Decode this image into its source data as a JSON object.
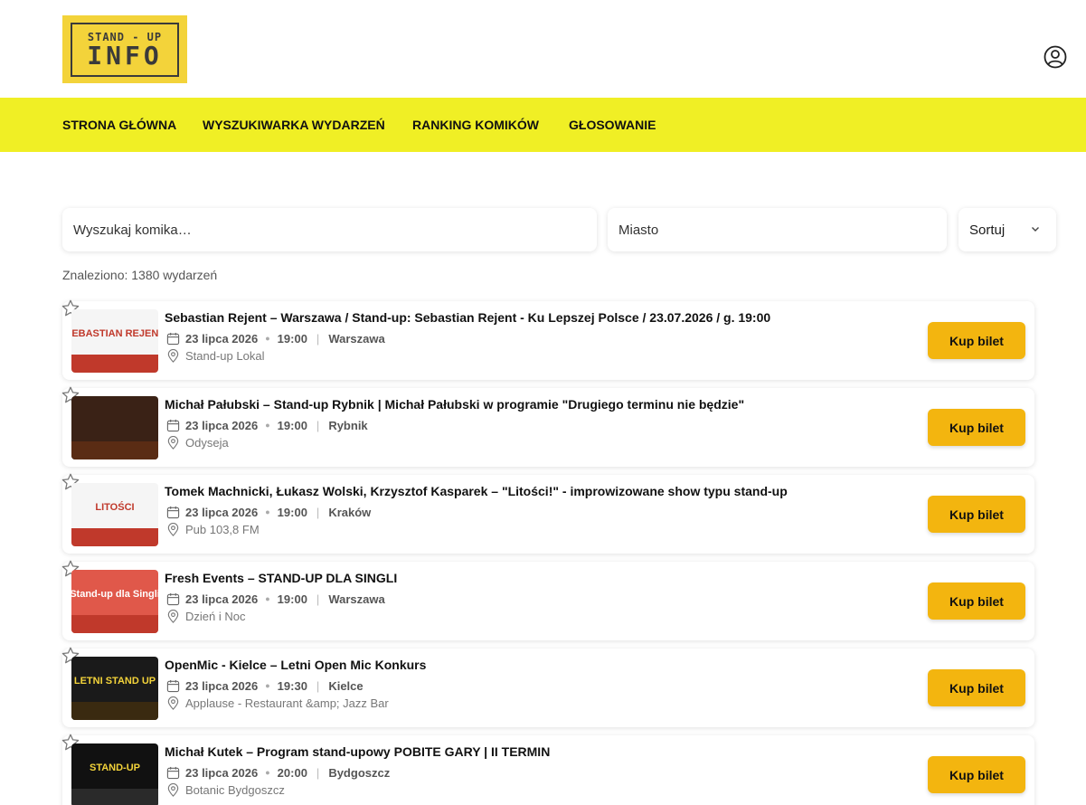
{
  "logo": {
    "top": "STAND - UP",
    "bottom": "INFO"
  },
  "nav": [
    {
      "label": "STRONA GŁÓWNA"
    },
    {
      "label": "WYSZUKIWARKA WYDARZEŃ"
    },
    {
      "label": "RANKING KOMIKÓW"
    },
    {
      "label": "GŁOSOWANIE"
    }
  ],
  "search": {
    "comedian_placeholder": "Wyszukaj komika…",
    "city_placeholder": "Miasto",
    "sort_label": "Sortuj"
  },
  "found_text": "Znaleziono: 1380 wydarzeń",
  "buy_label": "Kup bilet",
  "colors": {
    "nav_bg": "#f0ef25",
    "button": "#f3b50f",
    "logo_bg": "#f3d33a"
  },
  "events": [
    {
      "title": "Sebastian Rejent – Warszawa / Stand-up: Sebastian Rejent - Ku Lepszej Polsce / 23.07.2026 / g. 19:00",
      "date": "23 lipca 2026",
      "time": "19:00",
      "city": "Warszawa",
      "venue": "Stand-up Lokal",
      "thumb_text": "SEBASTIAN REJENT"
    },
    {
      "title": "Michał Pałubski – Stand-up Rybnik | Michał Pałubski w programie \"Drugiego terminu nie będzie\"",
      "date": "23 lipca 2026",
      "time": "19:00",
      "city": "Rybnik",
      "venue": "Odyseja",
      "thumb_text": ""
    },
    {
      "title": "Tomek Machnicki, Łukasz Wolski, Krzysztof Kasparek – \"Litości!\" - improwizowane show typu stand-up",
      "date": "23 lipca 2026",
      "time": "19:00",
      "city": "Kraków",
      "venue": "Pub 103,8 FM",
      "thumb_text": "LITOŚCI"
    },
    {
      "title": "Fresh Events – STAND-UP DLA SINGLI",
      "date": "23 lipca 2026",
      "time": "19:00",
      "city": "Warszawa",
      "venue": "Dzień i Noc",
      "thumb_text": "Stand-up dla Singli"
    },
    {
      "title": "OpenMic - Kielce – Letni Open Mic Konkurs",
      "date": "23 lipca 2026",
      "time": "19:30",
      "city": "Kielce",
      "venue": "Applause - Restaurant &amp; Jazz Bar",
      "thumb_text": "LETNI STAND UP"
    },
    {
      "title": "Michał Kutek – Program stand-upowy POBITE GARY | II TERMIN",
      "date": "23 lipca 2026",
      "time": "20:00",
      "city": "Bydgoszcz",
      "venue": "Botanic Bydgoszcz",
      "thumb_text": "STAND-UP"
    }
  ]
}
